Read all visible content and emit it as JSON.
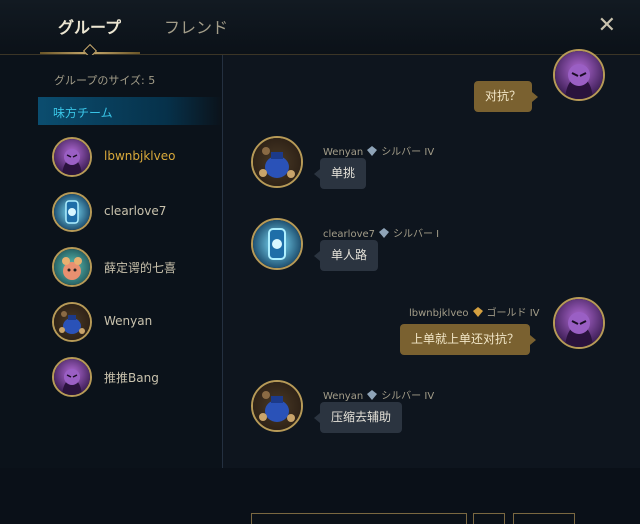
{
  "tabs": {
    "active": "グループ",
    "inactive": "フレンド"
  },
  "close_icon": "close-icon",
  "sidebar": {
    "group_size": "グループのサイズ: 5",
    "team_label": "味方チーム",
    "members": [
      {
        "name": "lbwnbjklveo",
        "self": true
      },
      {
        "name": "clearlove7"
      },
      {
        "name": "薛定谔的七喜"
      },
      {
        "name": "Wenyan"
      },
      {
        "name": "推推Bang"
      }
    ]
  },
  "chat": {
    "messages": [
      {
        "text": "对抗？",
        "from_self": true
      },
      {
        "sender": "Wenyan",
        "rank": "シルバー IV",
        "text": "单挑"
      },
      {
        "sender": "clearlove7",
        "rank": "シルバー I",
        "text": "单人路"
      },
      {
        "sender": "lbwnbjklveo",
        "rank": "ゴールド IV",
        "text": "上单就上单还对抗？",
        "from_self": true
      },
      {
        "sender": "Wenyan",
        "rank": "シルバー IV",
        "text": "压缩去辅助"
      }
    ]
  },
  "colors": {
    "accent_gold": "#c8aa6e",
    "team_blue": "#39c4e6",
    "self_name": "#d9a93a"
  }
}
